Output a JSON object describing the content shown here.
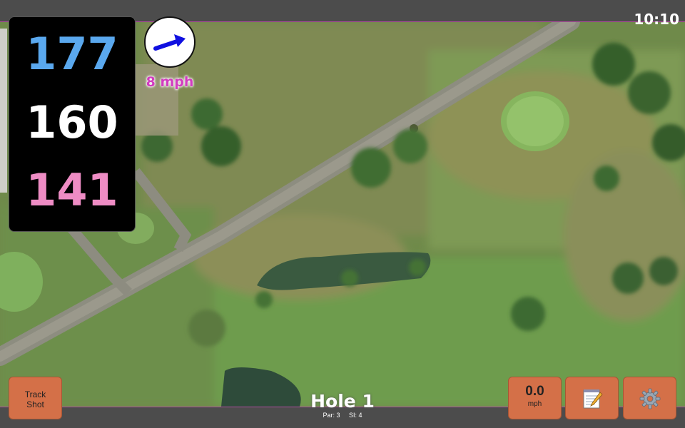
{
  "status_bar": {
    "time": "10:10"
  },
  "yardages": {
    "back": "177",
    "middle": "160",
    "front": "141"
  },
  "wind": {
    "speed_label": "8 mph",
    "direction_icon": "arrow-icon",
    "arrow_color": "#1010e0"
  },
  "buttons": {
    "track_shot_line1": "Track",
    "track_shot_line2": "Shot",
    "wind_value": "0.0",
    "wind_unit": "mph",
    "notes_icon": "notepad-icon",
    "settings_icon": "gear-icon"
  },
  "hole": {
    "title": "Hole 1",
    "par": "Par: 3",
    "si": "SI: 4"
  },
  "colors": {
    "back_yardage": "#5aa8ee",
    "middle_yardage": "#ffffff",
    "front_yardage": "#ee8cc4",
    "button": "#d47048",
    "bar_accent": "#b04aa0"
  }
}
